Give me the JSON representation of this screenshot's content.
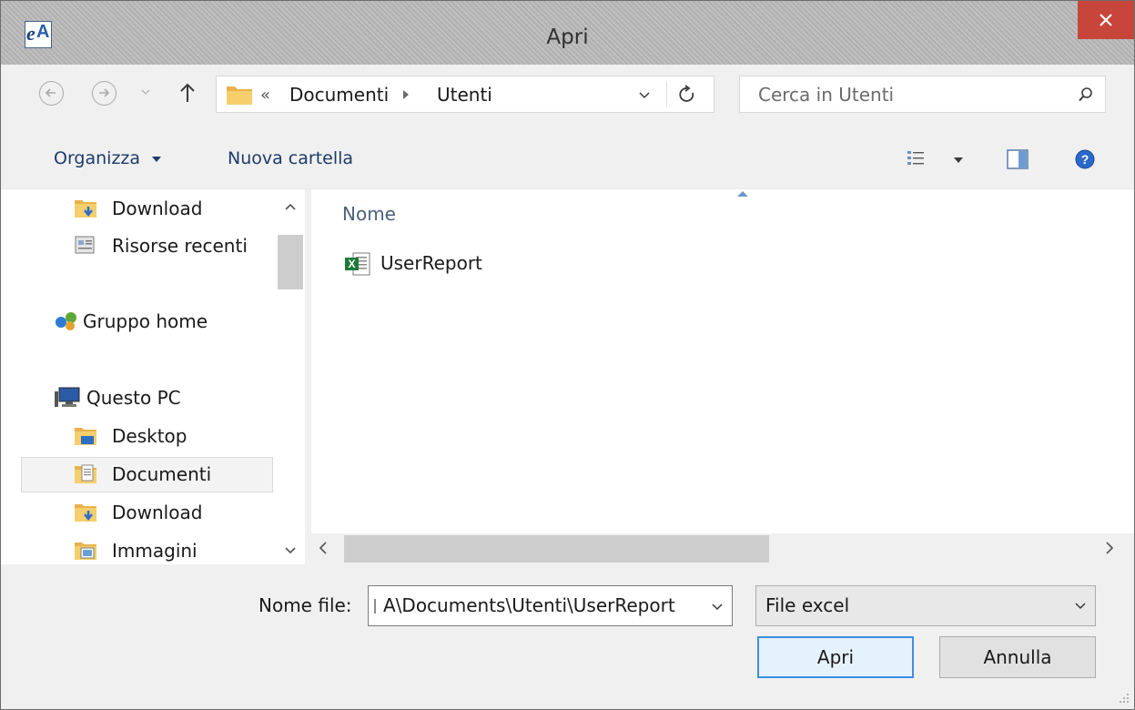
{
  "window": {
    "title": "Apri",
    "app_icon_text": "eA"
  },
  "nav": {
    "address": {
      "overflow": "«",
      "segments": [
        "Documenti",
        "Utenti"
      ]
    },
    "search_placeholder": "Cerca in Utenti"
  },
  "toolbar": {
    "organize_label": "Organizza",
    "new_folder_label": "Nuova cartella"
  },
  "sidebar": {
    "items": [
      {
        "label": "Download",
        "icon": "download-folder-icon"
      },
      {
        "label": "Risorse recenti",
        "icon": "recent-places-icon"
      },
      {
        "label": "Gruppo home",
        "icon": "homegroup-icon"
      },
      {
        "label": "Questo PC",
        "icon": "computer-icon"
      },
      {
        "label": "Desktop",
        "icon": "desktop-folder-icon"
      },
      {
        "label": "Documenti",
        "icon": "documents-folder-icon",
        "selected": true
      },
      {
        "label": "Download",
        "icon": "download-folder-icon"
      },
      {
        "label": "Immagini",
        "icon": "pictures-folder-icon"
      }
    ]
  },
  "content": {
    "columns": [
      "Nome"
    ],
    "files": [
      {
        "name": "UserReport",
        "icon": "excel-file-icon"
      }
    ]
  },
  "footer": {
    "filename_label": "Nome file:",
    "filename_value": "A\\Documents\\Utenti\\UserReport",
    "filetype_value": "File excel",
    "open_label": "Apri",
    "cancel_label": "Annulla"
  },
  "colors": {
    "close_button": "#c7453a",
    "default_button_border": "#3d8ee2",
    "link_text": "#1d3b68"
  }
}
